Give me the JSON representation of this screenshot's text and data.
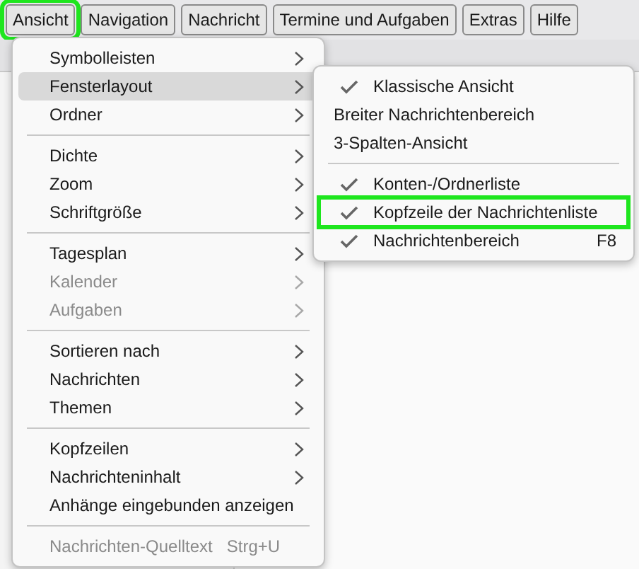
{
  "menubar": [
    {
      "label": "Ansicht",
      "highlighted": true
    },
    {
      "label": "Navigation",
      "highlighted": false
    },
    {
      "label": "Nachricht",
      "highlighted": false
    },
    {
      "label": "Termine und Aufgaben",
      "highlighted": false
    },
    {
      "label": "Extras",
      "highlighted": false
    },
    {
      "label": "Hilfe",
      "highlighted": false
    }
  ],
  "menu": [
    {
      "kind": "item",
      "label": "Symbolleisten",
      "submenu": true,
      "disabled": false,
      "selected": false
    },
    {
      "kind": "item",
      "label": "Fensterlayout",
      "submenu": true,
      "disabled": false,
      "selected": true
    },
    {
      "kind": "item",
      "label": "Ordner",
      "submenu": true,
      "disabled": false,
      "selected": false
    },
    {
      "kind": "separator"
    },
    {
      "kind": "item",
      "label": "Dichte",
      "submenu": true,
      "disabled": false,
      "selected": false
    },
    {
      "kind": "item",
      "label": "Zoom",
      "submenu": true,
      "disabled": false,
      "selected": false
    },
    {
      "kind": "item",
      "label": "Schriftgröße",
      "submenu": true,
      "disabled": false,
      "selected": false
    },
    {
      "kind": "separator"
    },
    {
      "kind": "item",
      "label": "Tagesplan",
      "submenu": true,
      "disabled": false,
      "selected": false
    },
    {
      "kind": "item",
      "label": "Kalender",
      "submenu": true,
      "disabled": true,
      "selected": false
    },
    {
      "kind": "item",
      "label": "Aufgaben",
      "submenu": true,
      "disabled": true,
      "selected": false
    },
    {
      "kind": "separator"
    },
    {
      "kind": "item",
      "label": "Sortieren nach",
      "submenu": true,
      "disabled": false,
      "selected": false
    },
    {
      "kind": "item",
      "label": "Nachrichten",
      "submenu": true,
      "disabled": false,
      "selected": false
    },
    {
      "kind": "item",
      "label": "Themen",
      "submenu": true,
      "disabled": false,
      "selected": false
    },
    {
      "kind": "separator"
    },
    {
      "kind": "item",
      "label": "Kopfzeilen",
      "submenu": true,
      "disabled": false,
      "selected": false
    },
    {
      "kind": "item",
      "label": "Nachrichteninhalt",
      "submenu": true,
      "disabled": false,
      "selected": false
    },
    {
      "kind": "item",
      "label": "Anhänge eingebunden anzeigen",
      "submenu": false,
      "disabled": false,
      "selected": false
    },
    {
      "kind": "separator"
    },
    {
      "kind": "item",
      "label": "Nachrichten-Quelltext",
      "shortcut": "Strg+U",
      "submenu": false,
      "disabled": true,
      "selected": false
    }
  ],
  "submenu": [
    {
      "kind": "item",
      "label": "Klassische Ansicht",
      "checked": true,
      "highlighted": false
    },
    {
      "kind": "item",
      "label": "Breiter Nachrichtenbereich",
      "checked": false,
      "highlighted": false
    },
    {
      "kind": "item",
      "label": "3-Spalten-Ansicht",
      "checked": false,
      "highlighted": false
    },
    {
      "kind": "separator"
    },
    {
      "kind": "item",
      "label": "Konten-/Ordnerliste",
      "checked": true,
      "highlighted": false
    },
    {
      "kind": "item",
      "label": "Kopfzeile der Nachrichtenliste",
      "checked": true,
      "highlighted": true
    },
    {
      "kind": "item",
      "label": "Nachrichtenbereich",
      "shortcut": "F8",
      "checked": true,
      "highlighted": false
    }
  ]
}
